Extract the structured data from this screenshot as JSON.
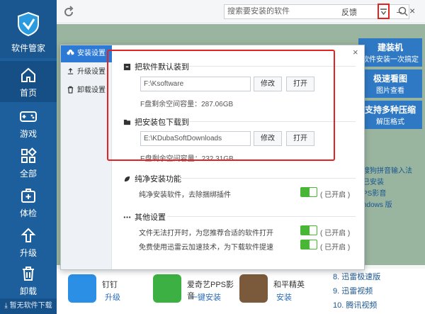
{
  "app": {
    "name": "软件管家",
    "footer": "暂无软件下载"
  },
  "nav": {
    "items": [
      {
        "label": "首页",
        "icon": "home-icon"
      },
      {
        "label": "游戏",
        "icon": "gamepad-icon"
      },
      {
        "label": "全部",
        "icon": "grid-icon"
      },
      {
        "label": "体检",
        "icon": "medkit-icon"
      },
      {
        "label": "升级",
        "icon": "upgrade-icon"
      },
      {
        "label": "卸载",
        "icon": "trash-icon"
      }
    ]
  },
  "topbar": {
    "search_placeholder": "搜索要安装的软件",
    "feedback": "反馈",
    "minimize": "–",
    "close": "×"
  },
  "background": {
    "cards": [
      {
        "title": "建装机",
        "sub": "软件安装一次搞定"
      },
      {
        "title": "极速看图",
        "sub": "图片查看"
      },
      {
        "title": "支持多种压缩",
        "sub": "解压格式"
      }
    ],
    "right_items": [
      "搜狗拼音输入法",
      "已安装",
      "PS影音",
      "ndows 版"
    ],
    "apps": [
      {
        "name": "钉钉",
        "action": "升级"
      },
      {
        "name": "爱奇艺PPS影音",
        "action": "一键安装"
      },
      {
        "name": "和平精英",
        "action": "安装"
      }
    ],
    "hot_list": [
      "8. 迅雷极速版",
      "9. 迅雷视频",
      "10. 腾讯视频"
    ]
  },
  "dialog": {
    "close": "×",
    "tabs": [
      {
        "label": "安装设置",
        "icon": "cloud-download-icon"
      },
      {
        "label": "升级设置",
        "icon": "upload-icon"
      },
      {
        "label": "卸载设置",
        "icon": "trash-icon"
      }
    ],
    "install": {
      "title": "把软件默认装到",
      "path": "F:\\Ksoftware",
      "modify": "修改",
      "open": "打开",
      "space": "F盘剩余空间容量：287.06GB"
    },
    "download": {
      "title": "把安装包下载到",
      "path": "E:\\KDubaSoftDownloads",
      "modify": "修改",
      "open": "打开",
      "space": "E盘剩余空间容量：232.31GB"
    },
    "pure": {
      "title": "纯净安装功能",
      "desc": "纯净安装软件，去除捆绑插件",
      "state": "( 已开启 )",
      "enabled": true
    },
    "other": {
      "title": "其他设置",
      "opt1": "文件无法打开时，为您推荐合适的软件打开",
      "opt1_state": "( 已开启 )",
      "opt2": "免费使用迅雷云加速技术，为下载软件提速",
      "opt2_state": "( 已开启 )"
    }
  },
  "colors": {
    "nav": "#1d5f9d",
    "accent": "#2c7ad6",
    "toggle": "#49b736",
    "highlight": "#e32222"
  }
}
